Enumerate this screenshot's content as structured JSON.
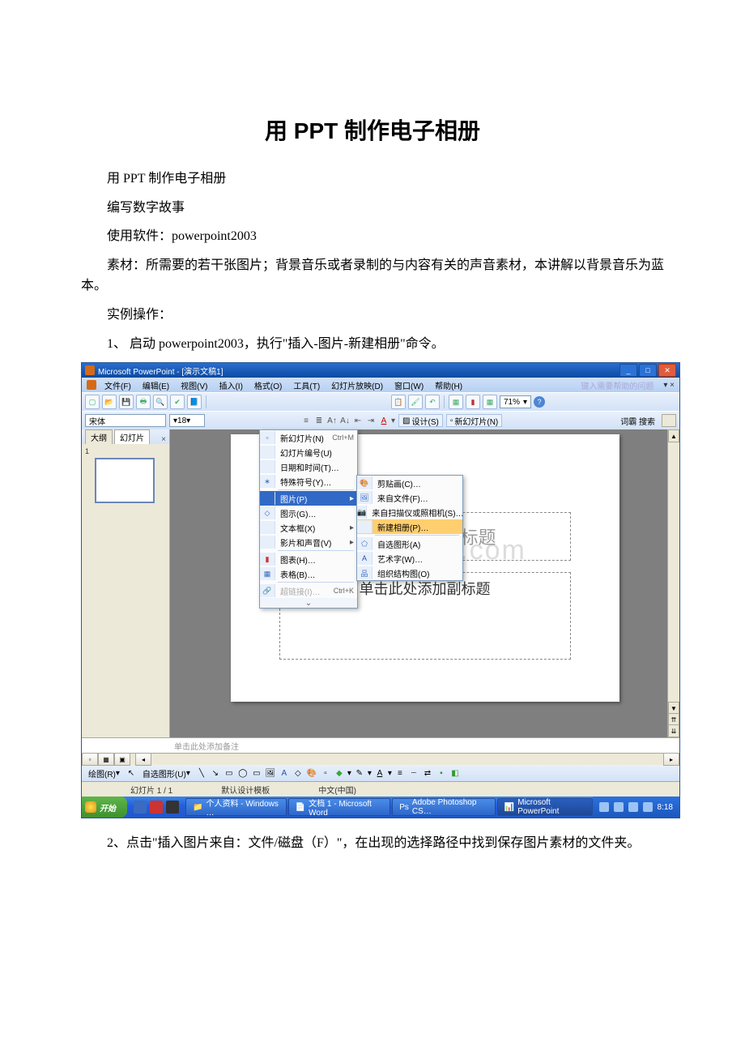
{
  "doc": {
    "title": "用 PPT 制作电子相册",
    "p1": "用 PPT 制作电子相册",
    "p2": "编写数字故事",
    "p3": "使用软件：powerpoint2003",
    "p4": "素材：所需要的若干张图片；背景音乐或者录制的与内容有关的声音素材，本讲解以背景音乐为蓝本。",
    "p5": "实例操作：",
    "p6": "1、 启动 powerpoint2003，执行\"插入-图片-新建相册\"命令。",
    "p7": "2、点击\"插入图片来自：文件/磁盘（F）\"，在出现的选择路径中找到保存图片素材的文件夹。"
  },
  "ppt": {
    "title": "Microsoft PowerPoint - [演示文稿1]",
    "help_prompt": "键入需要帮助的问题",
    "menus": {
      "file": "文件(F)",
      "edit": "编辑(E)",
      "view": "视图(V)",
      "insert": "插入(I)",
      "format": "格式(O)",
      "tools": "工具(T)",
      "slideshow": "幻灯片放映(D)",
      "window": "窗口(W)",
      "help": "帮助(H)"
    },
    "font_name": "宋体",
    "font_size": "18",
    "zoom": "71%",
    "design": "设计(S)",
    "newslide": "新幻灯片(N)",
    "wr": "词霸 搜索",
    "tabs": {
      "outline": "大纲",
      "slides": "幻灯片"
    },
    "slide": {
      "title_ph": "单击此处添加标题",
      "sub_ph": "单击此处添加副标题",
      "notes_ph": "单击此处添加备注"
    },
    "watermark": "www.docx.com",
    "insert_menu": {
      "newslide": "新幻灯片(N)",
      "newslide_sc": "Ctrl+M",
      "slidenum": "幻灯片编号(U)",
      "datetime": "日期和时间(T)…",
      "symbol": "特殊符号(Y)…",
      "picture": "图片(P)",
      "diagram": "图示(G)…",
      "textbox": "文本框(X)",
      "movie": "影片和声音(V)",
      "chart": "图表(H)…",
      "table": "表格(B)…",
      "hyperlink": "超链接(I)…",
      "hyperlink_sc": "Ctrl+K"
    },
    "picture_submenu": {
      "clipart": "剪贴画(C)…",
      "fromfile": "来自文件(F)…",
      "scanner": "来自扫描仪或照相机(S)…",
      "album": "新建相册(P)…",
      "autoshape": "自选图形(A)",
      "wordart": "艺术字(W)…",
      "orgchart": "组织结构图(O)"
    },
    "draw": {
      "label": "绘图(R)",
      "autoshape": "自选图形(U)"
    },
    "status": {
      "slide": "幻灯片 1 / 1",
      "template": "默认设计模板",
      "lang": "中文(中国)"
    }
  },
  "taskbar": {
    "start": "开始",
    "tasks": [
      "个人资料 - Windows …",
      "文档 1 - Microsoft Word",
      "Adobe Photoshop CS…",
      "Microsoft PowerPoint"
    ],
    "time": "8:18"
  }
}
